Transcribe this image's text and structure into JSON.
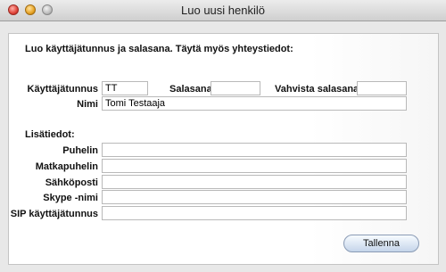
{
  "window": {
    "title": "Luo uusi henkilö"
  },
  "form": {
    "intro": "Luo käyttäjätunnus ja salasana. Täytä myös yhteystiedot:",
    "username_label": "Käyttäjätunnus",
    "username_value": "TT",
    "password_label": "Salasana",
    "password_value": "",
    "confirm_label": "Vahvista salasana",
    "confirm_value": "",
    "name_label": "Nimi",
    "name_value": "Tomi Testaaja",
    "section_title": "Lisätiedot:",
    "phone_label": "Puhelin",
    "phone_value": "",
    "mobile_label": "Matkapuhelin",
    "mobile_value": "",
    "email_label": "Sähköposti",
    "email_value": "",
    "skype_label": "Skype -nimi",
    "skype_value": "",
    "sip_label": "SIP käyttäjätunnus",
    "sip_value": "",
    "save_label": "Tallenna"
  }
}
